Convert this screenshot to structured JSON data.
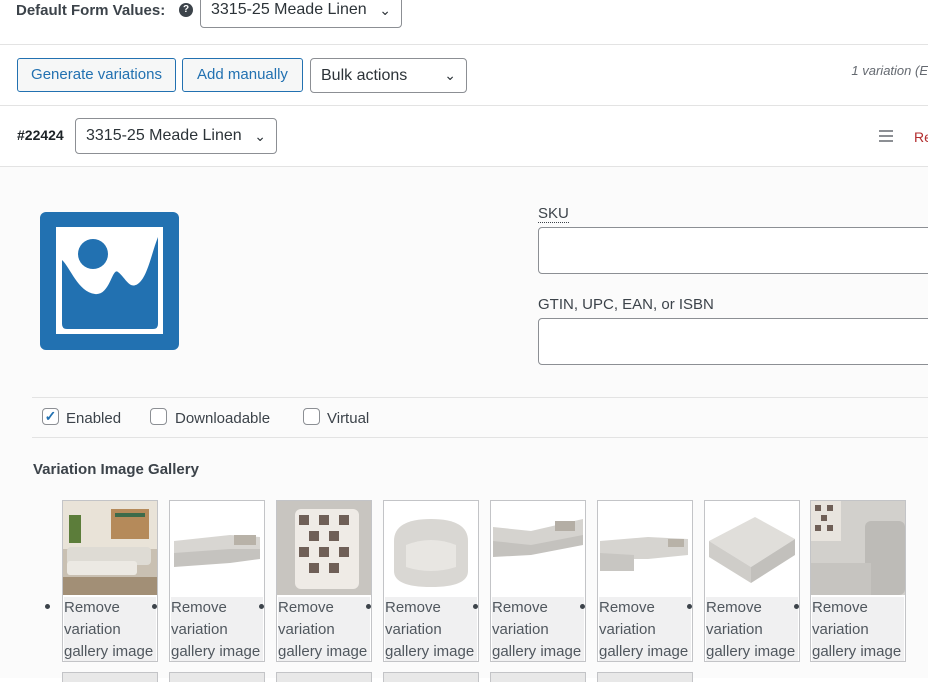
{
  "default_form": {
    "label": "Default Form Values:",
    "help_icon": "help-icon",
    "value": "3315-25 Meade Linen"
  },
  "toolbar": {
    "generate_label": "Generate variations",
    "add_manually_label": "Add manually",
    "bulk_actions_value": "Bulk actions",
    "variation_count": "1 variation (E"
  },
  "variation": {
    "id": "#22424",
    "attribute_value": "3315-25 Meade Linen",
    "menu_icon": "hamburger-menu-icon",
    "remove_label": "Re"
  },
  "image_placeholder_icon": "image-placeholder-icon",
  "fields": {
    "sku_label": "SKU",
    "sku_value": "",
    "gtin_label": "GTIN, UPC, EAN, or ISBN",
    "gtin_value": ""
  },
  "options": {
    "enabled_label": "Enabled",
    "enabled_checked": true,
    "downloadable_label": "Downloadable",
    "downloadable_checked": false,
    "virtual_label": "Virtual",
    "virtual_checked": false
  },
  "gallery": {
    "title": "Variation Image Gallery",
    "items": [
      {
        "image": "sectional-room-photo",
        "remove_label": "Remove variation gallery image"
      },
      {
        "image": "sectional-sofa-photo",
        "remove_label": "Remove variation gallery image"
      },
      {
        "image": "striped-pillow-photo",
        "remove_label": "Remove variation gallery image"
      },
      {
        "image": "swivel-chair-photo",
        "remove_label": "Remove variation gallery image"
      },
      {
        "image": "corner-sectional-photo",
        "remove_label": "Remove variation gallery image"
      },
      {
        "image": "chaise-sectional-photo",
        "remove_label": "Remove variation gallery image"
      },
      {
        "image": "ottoman-photo",
        "remove_label": "Remove variation gallery image"
      },
      {
        "image": "sofa-detail-photo",
        "remove_label": "Remove variation gallery image"
      }
    ]
  }
}
